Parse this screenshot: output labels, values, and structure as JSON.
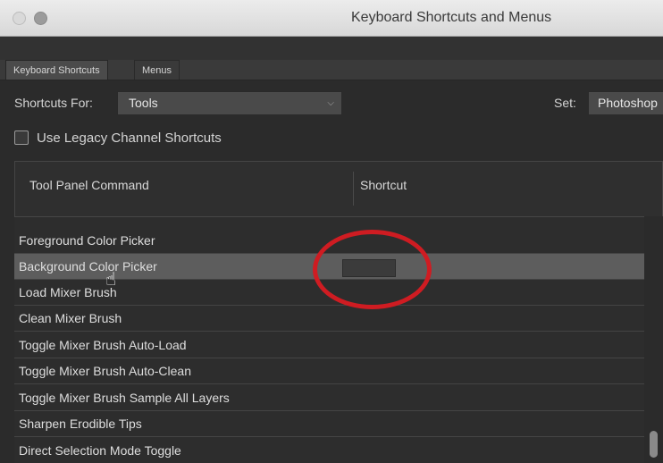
{
  "window": {
    "title": "Keyboard Shortcuts and Menus"
  },
  "tabs": [
    {
      "label": "Keyboard Shortcuts",
      "active": true
    },
    {
      "label": "Menus",
      "active": false
    }
  ],
  "shortcuts_for": {
    "label": "Shortcuts For:",
    "value": "Tools"
  },
  "set": {
    "label": "Set:",
    "value": "Photoshop"
  },
  "legacy": {
    "label": "Use Legacy Channel Shortcuts",
    "checked": false
  },
  "table": {
    "headers": {
      "command": "Tool Panel Command",
      "shortcut": "Shortcut"
    },
    "rows": [
      "Foreground Color Picker",
      "Background Color Picker",
      "Load Mixer Brush",
      "Clean Mixer Brush",
      "Toggle Mixer Brush Auto-Load",
      "Toggle Mixer Brush Auto-Clean",
      "Toggle Mixer Brush Sample All Layers",
      "Sharpen Erodible Tips",
      "Direct Selection Mode Toggle"
    ],
    "selected_row": "Background Color Picker"
  },
  "annotation": {
    "color": "#cf1c22",
    "shape": "ellipse"
  }
}
